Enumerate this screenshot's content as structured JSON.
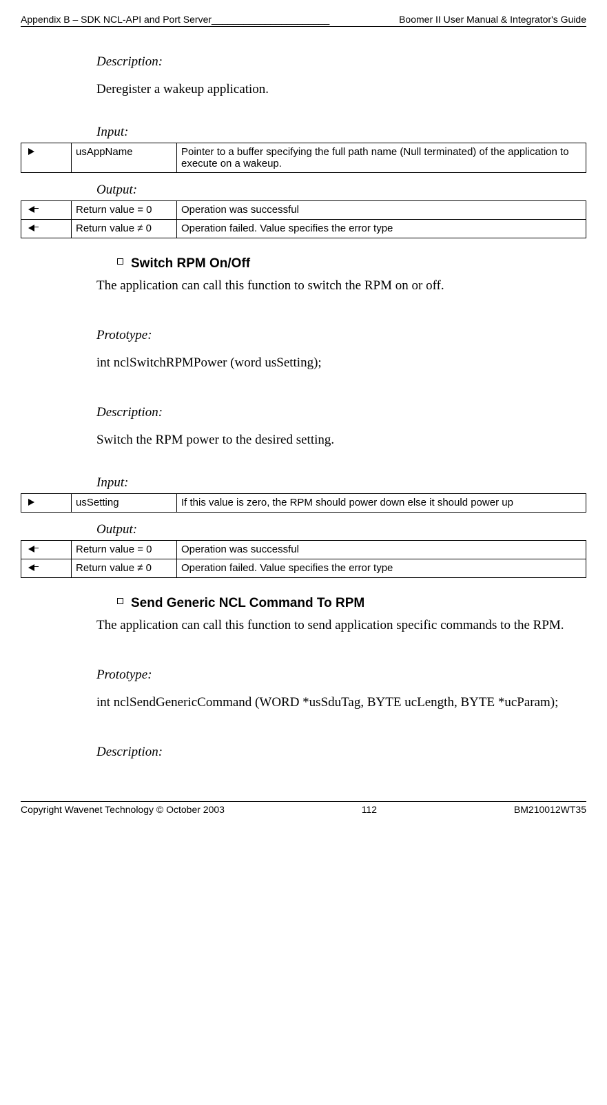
{
  "header": {
    "left": "Appendix B – SDK NCL-API and Port Server",
    "fill": "______________________",
    "right": " Boomer II User Manual & Integrator's Guide"
  },
  "sec1": {
    "desc_label": "Description:",
    "desc_text": "Deregister a wakeup application.",
    "input_label": "Input",
    "input_row": {
      "name": "usAppName",
      "text": "Pointer to a buffer specifying the full path name (Null terminated) of the application to execute on a wakeup."
    },
    "output_label": "Output:",
    "out_rows": [
      {
        "name": "Return value = 0",
        "text": "Operation was successful"
      },
      {
        "name": "Return value  ≠ 0",
        "text": "Operation failed. Value specifies the error type"
      }
    ]
  },
  "sec2": {
    "heading": "Switch RPM On/Off",
    "intro": "The application can call this function to switch the RPM on or off.",
    "proto_label": "Prototype:",
    "proto_text": "int nclSwitchRPMPower (word usSetting);",
    "desc_label": "Description:",
    "desc_text": "Switch the RPM power to the desired setting.",
    "input_label": "Input",
    "input_row": {
      "name": "usSetting",
      "text": "If this value is zero, the RPM should power down else it should power up"
    },
    "output_label": "Output:",
    "out_rows": [
      {
        "name": "Return value = 0",
        "text": "Operation was successful"
      },
      {
        "name": "Return value  ≠ 0",
        "text": "Operation failed. Value specifies the error type"
      }
    ]
  },
  "sec3": {
    "heading": "Send Generic NCL Command To RPM",
    "intro": "The application can call this function to send application specific commands to the RPM.",
    "proto_label": "Prototype:",
    "proto_text": "int nclSendGenericCommand (WORD *usSduTag, BYTE ucLength, BYTE *ucParam);",
    "desc_label": "Description:"
  },
  "footer": {
    "left": "Copyright Wavenet Technology © October 2003",
    "center": "112",
    "right": "BM210012WT35"
  }
}
